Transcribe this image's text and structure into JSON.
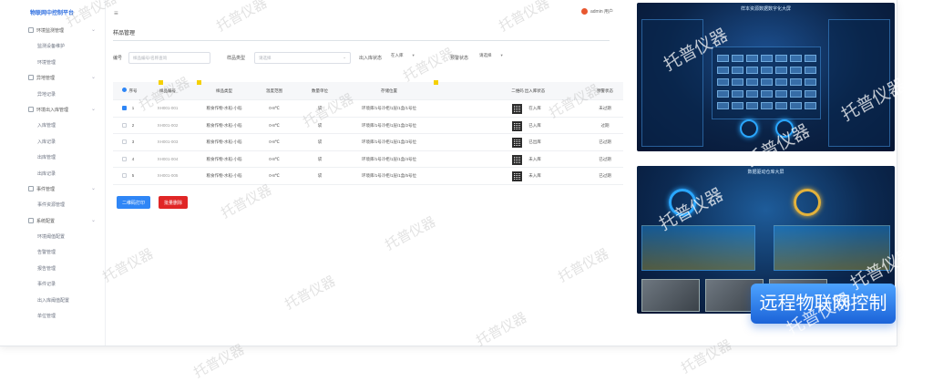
{
  "app": {
    "logo_text": "物联网中控制平台"
  },
  "header": {
    "menu_icon": "≡",
    "user_text": "admin 用户"
  },
  "sidebar": {
    "items": [
      {
        "label": "环境监测管理",
        "group": true
      },
      {
        "label": "监测设备维护",
        "group": false
      },
      {
        "label": "环境管理",
        "group": false
      },
      {
        "label": "异地管理",
        "group": true
      },
      {
        "label": "异地记录",
        "group": false
      },
      {
        "label": "环境出入库管理",
        "group": true
      },
      {
        "label": "入库管理",
        "group": false
      },
      {
        "label": "入库记录",
        "group": false
      },
      {
        "label": "出库管理",
        "group": false
      },
      {
        "label": "出库记录",
        "group": false
      },
      {
        "label": "事件管理",
        "group": true
      },
      {
        "label": "事件资源管理",
        "group": false
      },
      {
        "label": "系统配置",
        "group": true
      },
      {
        "label": "环境阈值配置",
        "group": false
      },
      {
        "label": "告警管理",
        "group": false
      },
      {
        "label": "报告管理",
        "group": false
      },
      {
        "label": "事件记录",
        "group": false
      },
      {
        "label": "出入库阈值配置",
        "group": false
      },
      {
        "label": "单位管理",
        "group": false
      }
    ]
  },
  "page": {
    "title": "样品管理",
    "filters": {
      "code_label": "编号",
      "code_placeholder": "样品编号/名称查询",
      "type_label": "样品类型",
      "type_placeholder": "请选择",
      "inout_label": "出入库状态",
      "inout_value": "在入库",
      "status_label": "预警状态",
      "status_value": "请选择"
    },
    "table": {
      "headers": [
        "序号",
        "样品编号",
        "样品类型",
        "温度范围",
        "数量单位",
        "存储位置",
        "二维码",
        "出入库状态",
        "预警状态"
      ],
      "rows": [
        {
          "checked": true,
          "index": "1",
          "code": "XH001-001",
          "type": "粮食作物-水稻-小稻",
          "temp": "0-8℃",
          "unit": "袋",
          "location": "环境库/1号冷柜/1层/1盒/1号位",
          "inout": "在入库",
          "status": "未过期"
        },
        {
          "checked": false,
          "index": "2",
          "code": "XH001-002",
          "type": "粮食作物-水稻-小稻",
          "temp": "0-8℃",
          "unit": "袋",
          "location": "环境库/1号冷柜/1层/1盒/2号位",
          "inout": "已入库",
          "status": "过期"
        },
        {
          "checked": false,
          "index": "3",
          "code": "XH001-003",
          "type": "粮食作物-水稻-小稻",
          "temp": "0-8℃",
          "unit": "袋",
          "location": "环境库/1号冷柜/1层/1盒/3号位",
          "inout": "已出库",
          "status": "已过期"
        },
        {
          "checked": false,
          "index": "4",
          "code": "XH001-004",
          "type": "粮食作物-水稻-小稻",
          "temp": "0-8℃",
          "unit": "袋",
          "location": "环境库/1号冷柜/1层/1盒/4号位",
          "inout": "未入库",
          "status": "已过期"
        },
        {
          "checked": false,
          "index": "5",
          "code": "XH001-005",
          "type": "粮食作物-水稻-小稻",
          "temp": "0-8℃",
          "unit": "袋",
          "location": "环境库/1号冷柜/1层/1盒/5号位",
          "inout": "未入库",
          "status": "已过期"
        }
      ]
    },
    "buttons": {
      "print_qr": "二维码打印",
      "batch_delete": "批量删除"
    }
  },
  "previews": {
    "top_title": "样本资源数据数字化大屏",
    "bottom_title": "数据驱动仓库大屏"
  },
  "badge": {
    "text": "远程物联网控制"
  },
  "watermark": {
    "text": "托普仪器"
  }
}
